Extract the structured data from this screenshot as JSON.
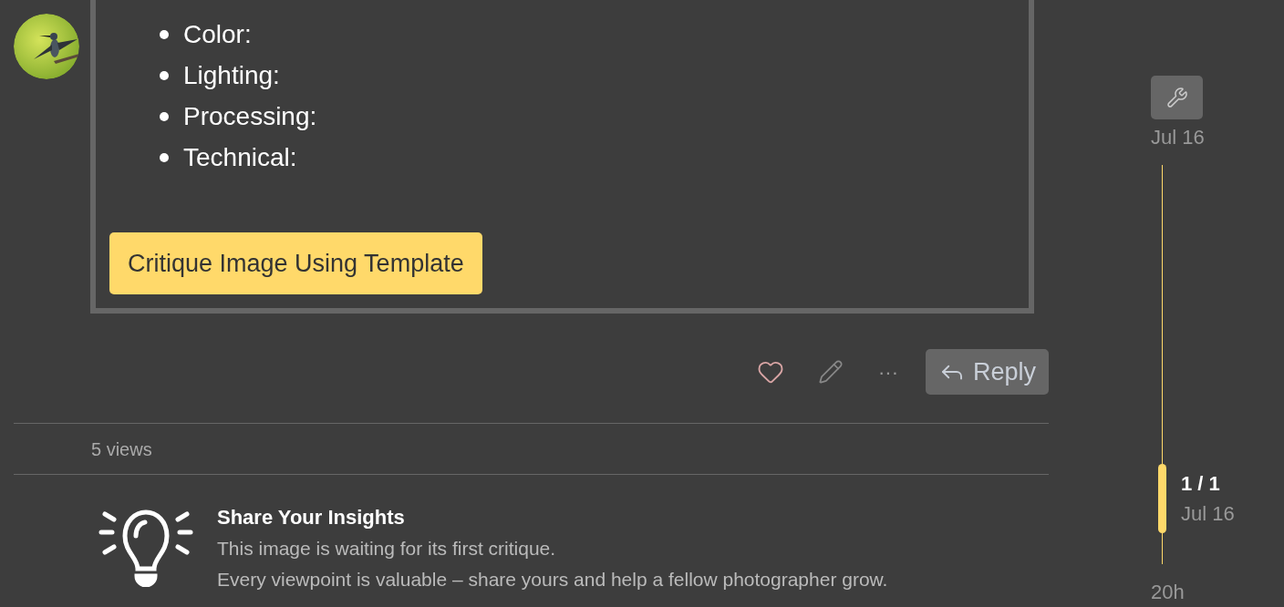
{
  "post": {
    "template_items": [
      "Color:",
      "Lighting:",
      "Processing:",
      "Technical:"
    ],
    "critique_button": "Critique Image Using Template"
  },
  "actions": {
    "more": "···",
    "reply": "Reply"
  },
  "views": "5 views",
  "insights": {
    "title": "Share Your Insights",
    "lines": [
      "This image is waiting for its first critique.",
      "Every viewpoint is valuable – share yours and help a fellow photographer grow."
    ]
  },
  "timeline": {
    "start_date": "Jul 16",
    "position": "1 / 1",
    "position_date": "Jul 16",
    "end_label": "20h"
  }
}
